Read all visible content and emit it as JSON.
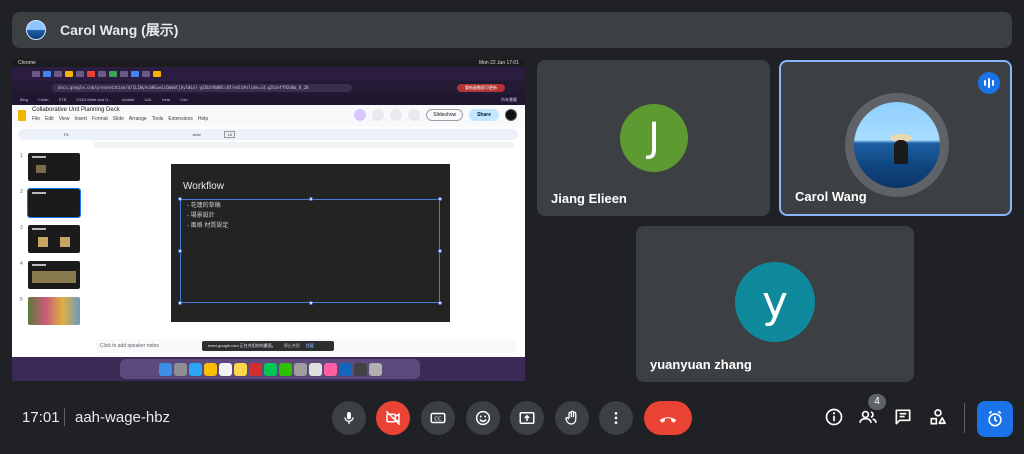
{
  "presenter": {
    "name": "Carol Wang (展示)"
  },
  "shared_screen": {
    "menubar": {
      "app": "Chrome",
      "clock": "Mon 22 Jan  17:01"
    },
    "url": "docs.google.com/presentation/d/1LIWyhcbHGue1cQwVmCjbvl0Lnl-gCEbt9bBNlc0f/edit#slide=id.g2b1eff92d0a_0_20",
    "url_pill": "重新啟動即可更新",
    "bookmarks": [
      "Blog",
      "Colab",
      "STB",
      "23/24 Meet and O...",
      "Update",
      "UAL",
      "beta",
      "Cdd",
      "所有書籤"
    ],
    "doc": {
      "title": "Collaborative Unit Planning Deck",
      "menu": [
        "File",
        "Edit",
        "View",
        "Insert",
        "Format",
        "Slide",
        "Arrange",
        "Tools",
        "Extensions",
        "Help"
      ],
      "slideshow_label": "Slideshow",
      "share_label": "Share",
      "toolbar_font": "Arial",
      "toolbar_size": "16",
      "toolbar_fit": "Fit",
      "thumbnail_numbers": [
        "1",
        "2",
        "3",
        "4",
        "5"
      ],
      "slide_title": "Workflow",
      "slide_bullets": [
        "-   花蓮的草稿",
        "-   場景設計",
        "-   風格 材質設定"
      ],
      "speaker_notes": "Click to add speaker notes"
    },
    "share_banner": {
      "text": "meet.google.com 正在共用你的畫面。",
      "stop": "停止共用",
      "hide": "隱藏"
    }
  },
  "participants": [
    {
      "name": "Jiang Elieen",
      "initial": "J",
      "color": "#5e9a32"
    },
    {
      "name": "Carol Wang",
      "speaking": true
    },
    {
      "name": "yuanyuan zhang",
      "initial": "y",
      "color": "#0f8a9d"
    }
  ],
  "bottom_bar": {
    "time": "17:01",
    "meeting_code": "aah-wage-hbz",
    "participant_count": "4",
    "icons": [
      "mic-icon",
      "camera-off-icon",
      "captions-icon",
      "emoji-icon",
      "present-icon",
      "raise-hand-icon",
      "more-icon",
      "hang-up-icon",
      "info-icon",
      "people-icon",
      "chat-icon",
      "activities-icon",
      "host-controls-icon"
    ]
  },
  "colors": {
    "background": "#202124",
    "tile": "#3c4043",
    "accent": "#1a73e8",
    "danger": "#ea4335"
  }
}
